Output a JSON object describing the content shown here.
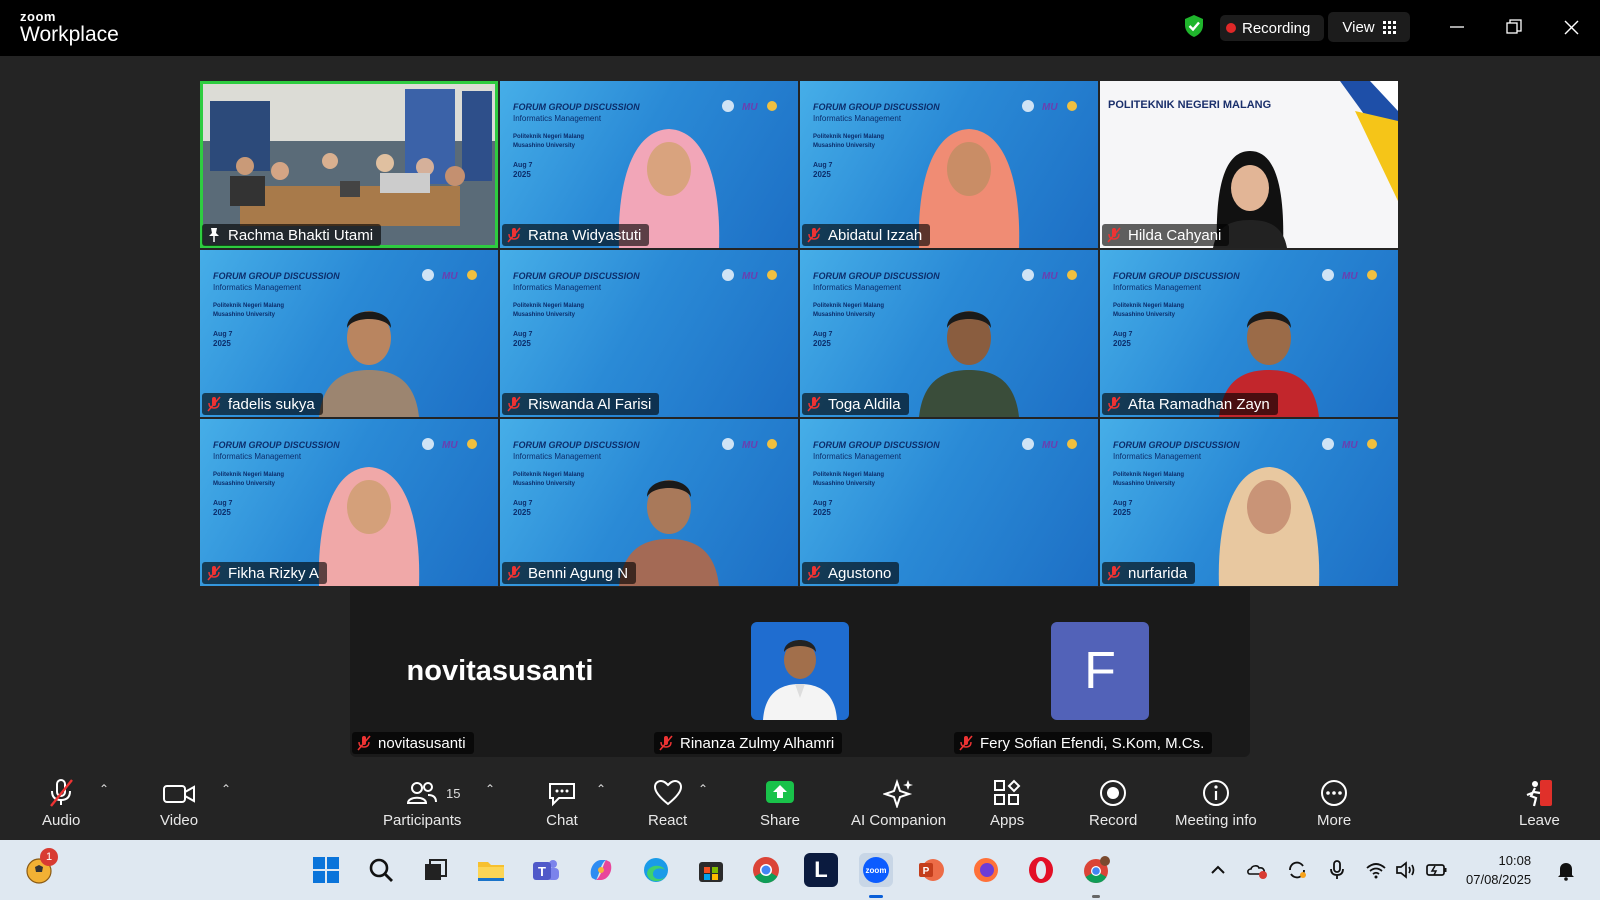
{
  "app": {
    "brand_top": "zoom",
    "brand_bottom": "Workplace"
  },
  "header": {
    "recording_label": "Recording",
    "view_label": "View"
  },
  "participants_grid": [
    {
      "name": "Rachma Bhakti Utami",
      "type": "room",
      "active": true
    },
    {
      "name": "Ratna Widyastuti",
      "type": "slide"
    },
    {
      "name": "Abidatul Izzah",
      "type": "slide"
    },
    {
      "name": "Hilda Cahyani",
      "type": "polinema"
    },
    {
      "name": "fadelis sukya",
      "type": "slide"
    },
    {
      "name": "Riswanda Al Farisi",
      "type": "slide"
    },
    {
      "name": "Toga Aldila",
      "type": "slide"
    },
    {
      "name": "Afta Ramadhan Zayn",
      "type": "slide"
    },
    {
      "name": "Fikha Rizky A",
      "type": "slide"
    },
    {
      "name": "Benni Agung N",
      "type": "slide"
    },
    {
      "name": "Agustono",
      "type": "slide"
    },
    {
      "name": "nurfarida",
      "type": "slide"
    }
  ],
  "slide": {
    "title": "FORUM GROUP DISCUSSION",
    "subtitle": "Informatics Management",
    "line1": "Politeknik Negeri Malang",
    "line2": "Musashino University",
    "date1": "Aug 7",
    "date2": "2025"
  },
  "polinema_title": "POLITEKNIK NEGERI MALANG",
  "strip": {
    "p1": {
      "name": "novitasusanti",
      "display": "novitasusanti"
    },
    "p2": {
      "name": "Rinanza Zulmy Alhamri"
    },
    "p3": {
      "name": "Fery Sofian Efendi, S.Kom, M.Cs.",
      "initial": "F"
    }
  },
  "toolbar": {
    "audio": "Audio",
    "video": "Video",
    "participants": "Participants",
    "participants_count": "15",
    "chat": "Chat",
    "react": "React",
    "share": "Share",
    "ai": "AI Companion",
    "apps": "Apps",
    "record": "Record",
    "meeting_info": "Meeting info",
    "more": "More",
    "leave": "Leave"
  },
  "taskbar": {
    "notification_count": "1",
    "time": "10:08",
    "date": "07/08/2025"
  },
  "colors": {
    "active_border": "#2ecc40",
    "share_green": "#19c24a",
    "leave_red": "#e0302a"
  }
}
